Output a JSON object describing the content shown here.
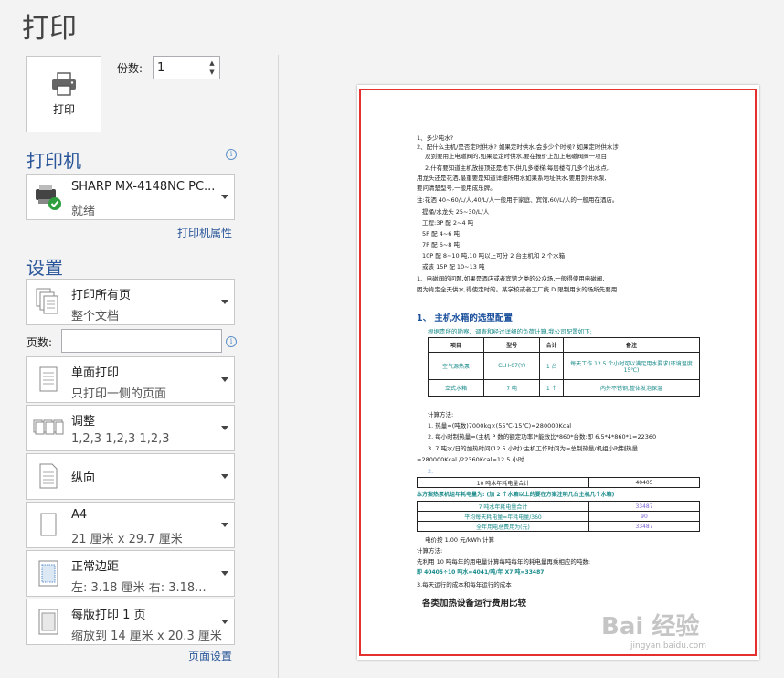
{
  "page_title": "打印",
  "print_button": {
    "label": "打印"
  },
  "copies": {
    "label": "份数:",
    "value": "1"
  },
  "printer": {
    "heading": "打印机",
    "name": "SHARP MX-4148NC PC...",
    "status": "就绪",
    "properties_link": "打印机属性"
  },
  "settings": {
    "heading": "设置",
    "pages_label": "页数:",
    "pages_value": "",
    "items": [
      {
        "title": "打印所有页",
        "subtitle": "整个文档"
      },
      {
        "title": "单面打印",
        "subtitle": "只打印一侧的页面"
      },
      {
        "title": "调整",
        "subtitle": "1,2,3    1,2,3    1,2,3"
      },
      {
        "title": "纵向",
        "subtitle": ""
      },
      {
        "title": "A4",
        "subtitle": "21 厘米 x 29.7 厘米"
      },
      {
        "title": "正常边距",
        "subtitle": "左: 3.18 厘米    右: 3.18..."
      },
      {
        "title": "每版打印 1 页",
        "subtitle": "缩放到 14 厘米 x 20.3 厘米"
      }
    ],
    "page_setup_link": "页面设置"
  },
  "document": {
    "lines_top": [
      "1、多少吨水?",
      "2、配什么主机/是否定时供水? 如果定时供水,会多少个时候? 如果定时供水涉",
      "及到要用上电磁阀的,如果是定时供水,要在报价上加上电磁阀阀一项目",
      "2.什有要知道主机放接顶还是地下,供几多楼梯,每层楼有几多个出水点,",
      "用龙头还是花洒,最重要是知道详细所用水如果系地址供水,要用到供水泵,",
      "要问清楚型号,一般用成乐牌。",
      "注:花洒 40~60/L/人,40/L/人一般用于家庭、宾馆,60/L/人的一般用在酒店。",
      "   提桶/水龙头 25~30/L/人",
      "   工程:3P 配 2~4 吨",
      "        5P 配 4~6 吨",
      "        7P 配 6~8 吨",
      "        10P 配 8~10 吨,10 吨以上可分 2 台主机和 2 个水箱",
      "     或该   15P 配 10~13 吨",
      "   1、电磁阀的问题,如果是酒店或者宾馆之类的公众场,一般得使用电磁阀,",
      "因为肯定全天供水,得使定时的。某学校或者工厂统 D 限制用水的场所先要用"
    ],
    "section_heading": "1、    主机水箱的选型配置",
    "section_sub": "根据贵所的勘察、调查和经过详细的负荷计算,我公司配置如下:",
    "table_headers": [
      "项目",
      "型号",
      "合计",
      "备注"
    ],
    "table_rows": [
      [
        "空气源热泵",
        "CLH-07(Y)",
        "1 台",
        "每天工作 12.5 个小时可以满足用水要求(环境温度 15℃)"
      ],
      [
        "立式水箱",
        "7 吨",
        "1 个",
        "内外不锈钢,整体发泡保温"
      ]
    ],
    "calc_lines": [
      "计算方法:",
      "1. 热量=(吨数)7000kg×(55℃-15℃)=280000Kcal",
      "2. 每小时制热量=(主机 P 数的额定功率)*能效比*860*台数:即 6.5*4*860*1=22360",
      "3. 7 吨水/日的加热时间(12.5 小时):主机工作时间为=总制热量/机组小时制热量",
      "=280000Kcal /22360Kcal=12.5 小时",
      "2."
    ],
    "summary_row": {
      "label": "10 吨水年耗电量合计",
      "value": "40405"
    },
    "compare_heading": "本方案热泵机组年耗电量为: (加 2 个水箱以上的要在方案注明几台主机几个水箱)",
    "compare_rows": [
      {
        "label": "7 吨水年耗电量合计",
        "value": "33487"
      },
      {
        "label": "平均每天耗电量=年耗电量/360",
        "value": "90"
      },
      {
        "label": "全年用电总费用为(元)",
        "value": "33487"
      }
    ],
    "lines_bottom": [
      "电价按 1.00 元/kWh 计算",
      "计算方法:",
      "先利用 10 吨每年的用电量计算每吨每年的耗电量再乘相应的吨数:",
      "即 40405÷10 吨水=4041/吨/年 X7 吨=33487",
      "3.每天运行的成本和每年运行的成本"
    ],
    "final_heading": "各类加热设备运行费用比较",
    "watermark": "Bai 经验",
    "watermark_url": "jingyan.baidu.com"
  },
  "colors": {
    "accent": "#2b579a",
    "highlight_box": "#e53030",
    "doc_heading": "#1a4f9c",
    "doc_teal": "#1a8a8a"
  }
}
